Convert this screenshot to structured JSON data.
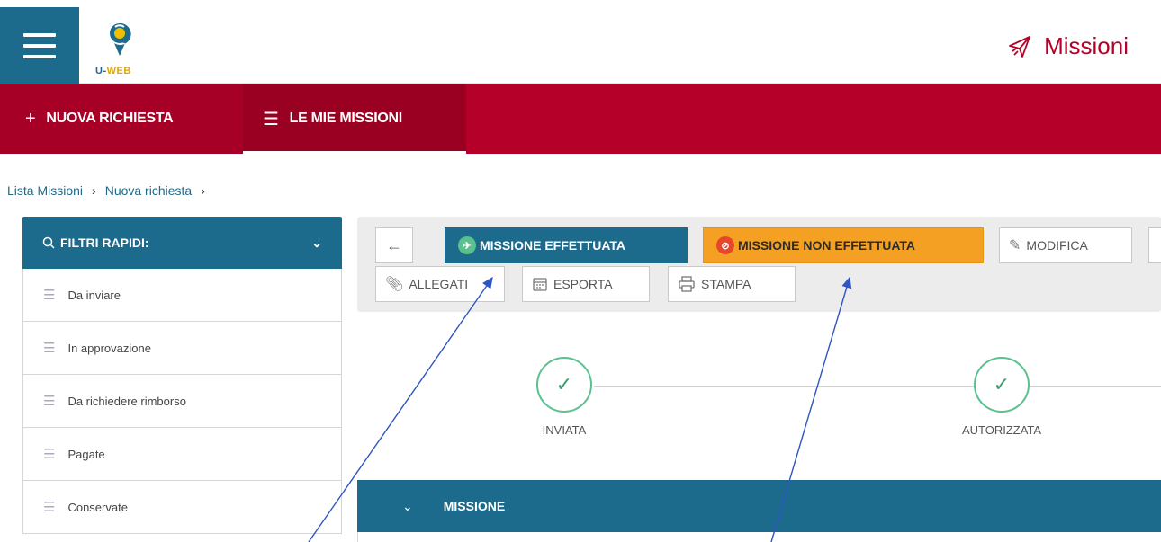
{
  "header": {
    "logo_text_u": "U-",
    "logo_text_web": "WEB",
    "app_title": "Missioni",
    "app_icon": "airplane-icon"
  },
  "nav": {
    "new_request": "NUOVA RICHIESTA",
    "my_missions": "LE MIE MISSIONI"
  },
  "breadcrumb": {
    "items": [
      "Lista Missioni",
      "Nuova richiesta"
    ]
  },
  "filters": {
    "title": "FILTRI RAPIDI:",
    "items": [
      "Da inviare",
      "In approvazione",
      "Da richiedere rimborso",
      "Pagate",
      "Conservate"
    ]
  },
  "toolbar": {
    "back": "←",
    "mission_done": "MISSIONE EFFETTUATA",
    "mission_not_done": "MISSIONE NON EFFETTUATA",
    "edit": "MODIFICA",
    "attachments": "ALLEGATI",
    "export": "ESPORTA",
    "print": "STAMPA"
  },
  "steps": [
    {
      "label": "INVIATA",
      "done": true
    },
    {
      "label": "AUTORIZZATA",
      "done": true
    }
  ],
  "section": {
    "title": "MISSIONE"
  },
  "colors": {
    "brand_teal": "#1d6b8c",
    "brand_red": "#b5002a",
    "warning_orange": "#f4a023",
    "success_green": "#5ac18e",
    "annotation_arrow": "#2f55c4"
  }
}
